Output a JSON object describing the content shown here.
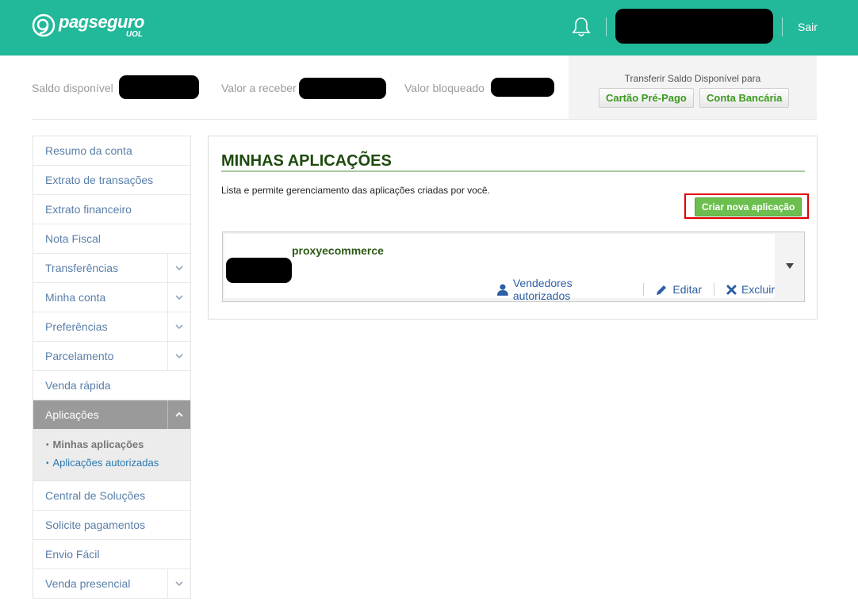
{
  "header": {
    "logo_text": "pagseguro",
    "logo_sub": "UOL",
    "logout_label": "Sair"
  },
  "balance": {
    "available_label": "Saldo disponível",
    "receivable_label": "Valor a receber",
    "blocked_label": "Valor bloqueado",
    "transfer_title": "Transferir Saldo Disponível para",
    "prepaid_button": "Cartão Pré-Pago",
    "bank_button": "Conta Bancária"
  },
  "sidebar": {
    "items": [
      {
        "label": "Resumo da conta"
      },
      {
        "label": "Extrato de transações"
      },
      {
        "label": "Extrato financeiro"
      },
      {
        "label": "Nota Fiscal"
      },
      {
        "label": "Transferências"
      },
      {
        "label": "Minha conta"
      },
      {
        "label": "Preferências"
      },
      {
        "label": "Parcelamento"
      },
      {
        "label": "Venda rápida"
      },
      {
        "label": "Aplicações"
      },
      {
        "label": "Central de Soluções"
      },
      {
        "label": "Solicite pagamentos"
      },
      {
        "label": "Envio Fácil"
      },
      {
        "label": "Venda presencial"
      }
    ],
    "submenu": [
      {
        "label": "Minhas aplicações"
      },
      {
        "label": "Aplicações autorizadas"
      }
    ]
  },
  "main": {
    "title": "MINHAS APLICAÇÕES",
    "description": "Lista e permite gerenciamento das aplicações criadas por você.",
    "create_button": "Criar nova aplicação",
    "apps": [
      {
        "name": "proxyecommerce",
        "actions": {
          "sellers": "Vendedores autorizados",
          "edit": "Editar",
          "delete": "Excluir"
        }
      }
    ]
  },
  "colors": {
    "brand": "#22b89a",
    "title_green": "#1e4a0e",
    "link_blue": "#2c5fa3",
    "create_green": "#6cbf4f",
    "highlight_red": "#e00000"
  }
}
